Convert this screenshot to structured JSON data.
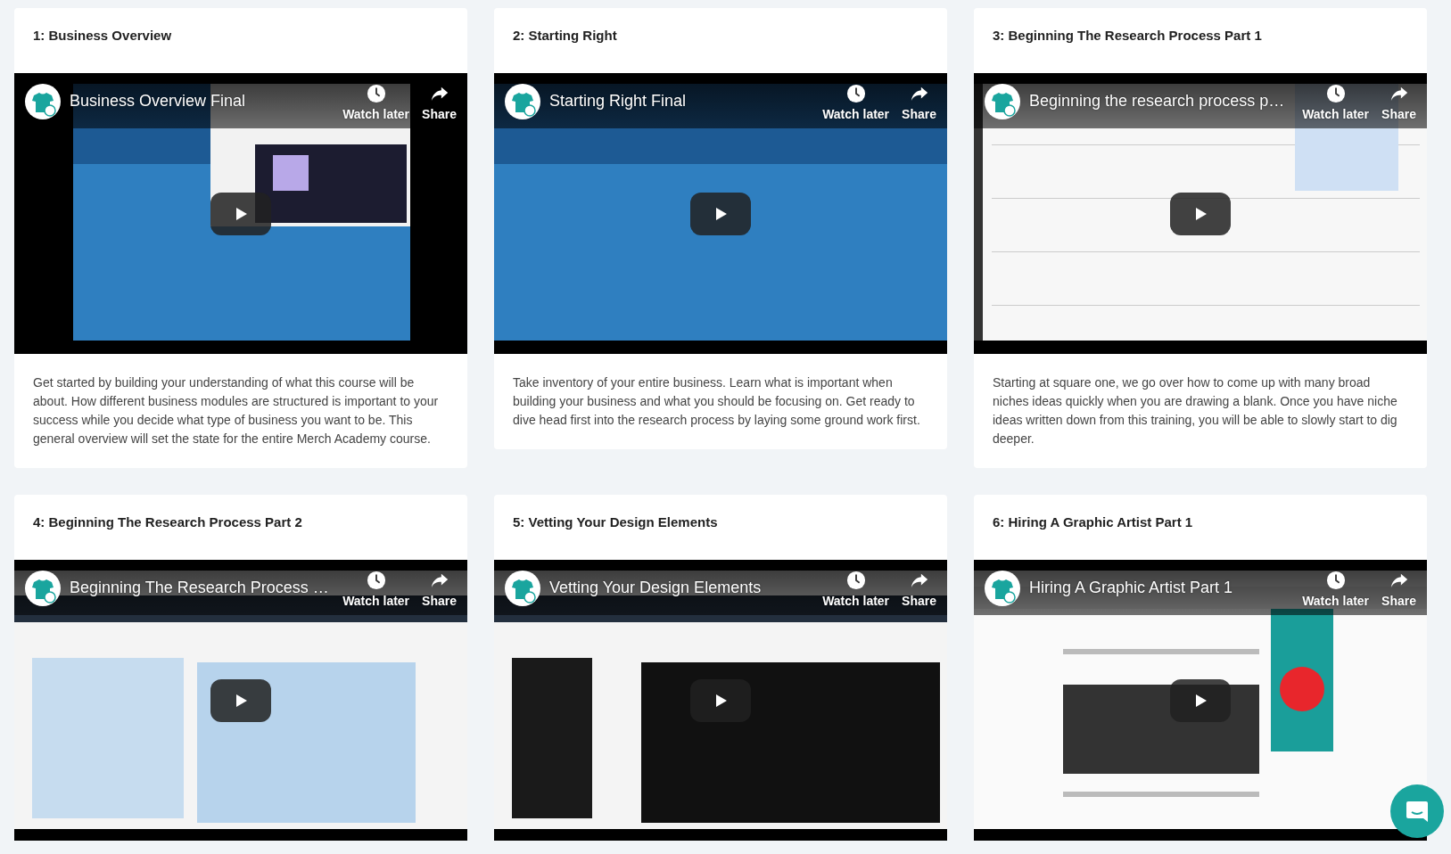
{
  "lessons": [
    {
      "title": "1: Business Overview",
      "video": {
        "title": "Business Overview Final",
        "watch_later": "Watch later",
        "share": "Share"
      },
      "description": "Get started by building your understanding of what this course will be about. How different business modules are structured is important to your success while you decide what type of business you want to be. This general overview will set the state for the entire Merch Academy course."
    },
    {
      "title": "2: Starting Right",
      "video": {
        "title": "Starting Right Final",
        "watch_later": "Watch later",
        "share": "Share"
      },
      "description": "Take inventory of your entire business. Learn what is important when building your business and what you should be focusing on. Get ready to dive head first into the research process by laying some ground work first."
    },
    {
      "title": "3: Beginning The Research Process Part 1",
      "video": {
        "title": "Beginning the research process p…",
        "watch_later": "Watch later",
        "share": "Share"
      },
      "description": "Starting at square one, we go over how to come up with many broad niches ideas quickly when you are drawing a blank. Once you have niche ideas written down from this training, you will be able to slowly start to dig deeper."
    },
    {
      "title": "4: Beginning The Research Process Part 2",
      "video": {
        "title": "Beginning The Research Process …",
        "watch_later": "Watch later",
        "share": "Share"
      }
    },
    {
      "title": "5: Vetting Your Design Elements",
      "video": {
        "title": "Vetting Your Design Elements",
        "watch_later": "Watch later",
        "share": "Share"
      }
    },
    {
      "title": "6: Hiring A Graphic Artist Part 1",
      "video": {
        "title": "Hiring A Graphic Artist Part 1",
        "watch_later": "Watch later",
        "share": "Share"
      }
    }
  ]
}
